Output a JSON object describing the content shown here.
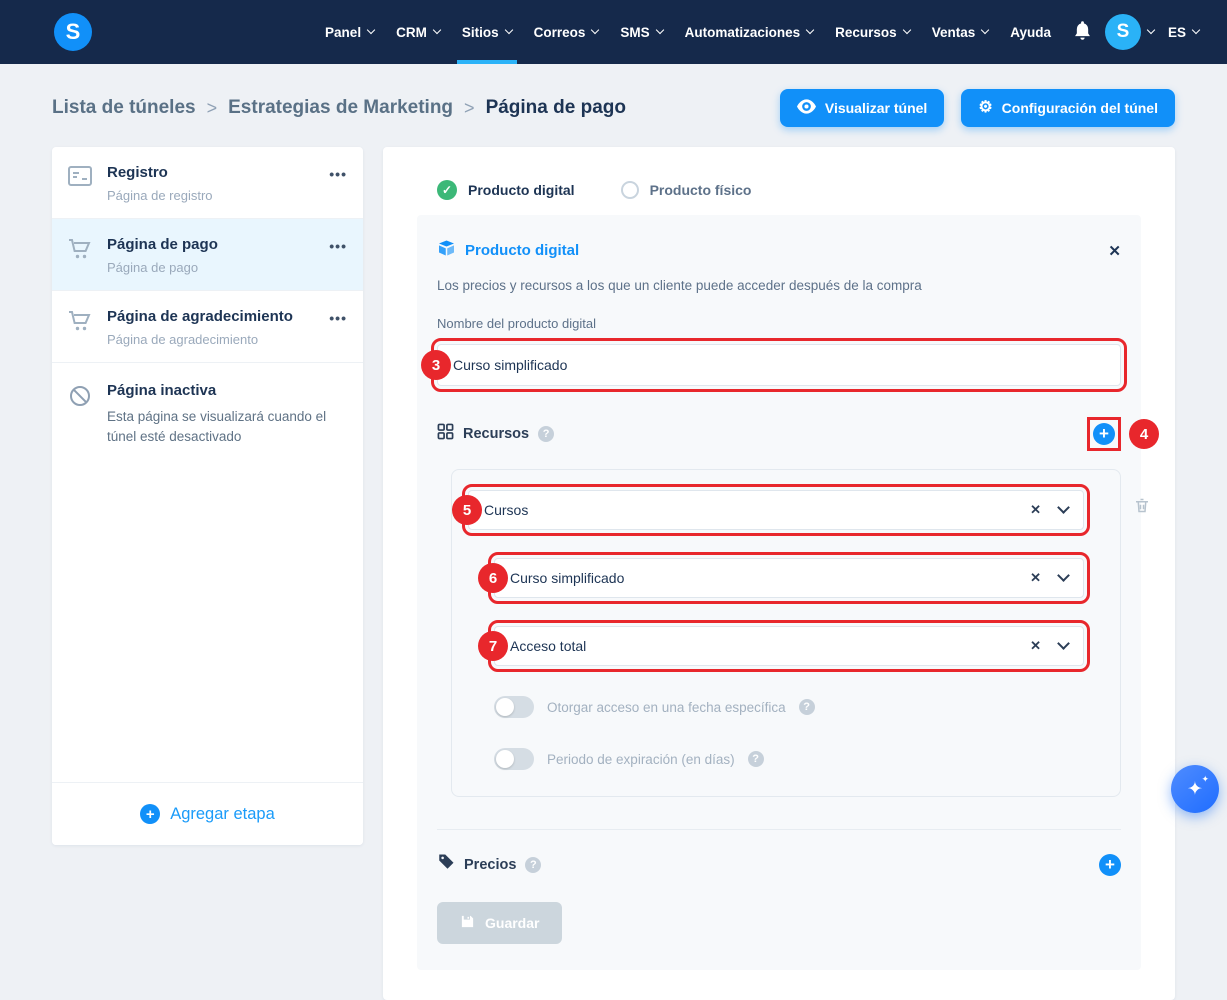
{
  "colors": {
    "navbar_bg": "#15294b",
    "accent_blue": "#1190f9",
    "active_nav_underline": "#2bb3f8",
    "annotation_red": "#e8272c",
    "success_green": "#3cb878",
    "page_bg": "#eef1f5",
    "panel_bg": "#f7f9fb",
    "disabled_button": "#ccd6dd",
    "selected_stage_bg": "#e9f6fe"
  },
  "navbar": {
    "logo_letter": "S",
    "items": [
      {
        "label": "Panel"
      },
      {
        "label": "CRM"
      },
      {
        "label": "Sitios"
      },
      {
        "label": "Correos"
      },
      {
        "label": "SMS"
      },
      {
        "label": "Automatizaciones"
      },
      {
        "label": "Recursos"
      },
      {
        "label": "Ventas"
      },
      {
        "label": "Ayuda"
      }
    ],
    "avatar_letter": "S",
    "language": "ES"
  },
  "breadcrumb": {
    "items": [
      "Lista de túneles",
      "Estrategias de Marketing",
      "Página de pago"
    ],
    "separator": ">"
  },
  "header_actions": {
    "visualize_label": "Visualizar túnel",
    "configure_label": "Configuración del túnel"
  },
  "sidebar": {
    "stages": [
      {
        "title": "Registro",
        "subtitle": "Página de registro"
      },
      {
        "title": "Página de pago",
        "subtitle": "Página de pago"
      },
      {
        "title": "Página de agradecimiento",
        "subtitle": "Página de agradecimiento"
      }
    ],
    "inactive": {
      "title": "Página inactiva",
      "description": "Esta página se visualizará cuando el túnel esté desactivado"
    },
    "add_stage_label": "Agregar etapa"
  },
  "main": {
    "tabs": [
      {
        "label": "Producto digital"
      },
      {
        "label": "Producto físico"
      }
    ],
    "product": {
      "title": "Producto digital",
      "description": "Los precios y recursos a los que un cliente puede acceder después de la compra",
      "name_label": "Nombre del producto digital",
      "name_value": "Curso simplificado",
      "resources_label": "Recursos",
      "selects": [
        {
          "value": "Cursos"
        },
        {
          "value": "Curso simplificado"
        },
        {
          "value": "Acceso total"
        }
      ],
      "toggles": [
        {
          "label": "Otorgar acceso en una fecha específica"
        },
        {
          "label": "Periodo de expiración (en días)"
        }
      ],
      "prices_label": "Precios",
      "save_label": "Guardar"
    }
  },
  "annotations": {
    "input_step": "3",
    "add_resource_step": "4",
    "select_steps": [
      "5",
      "6",
      "7"
    ]
  },
  "glyphs": {
    "close": "✕",
    "clear": "✕",
    "help": "?",
    "plus": "+",
    "check": "✓",
    "menu_dots": "•••",
    "gear": "⚙",
    "star": "✦"
  }
}
